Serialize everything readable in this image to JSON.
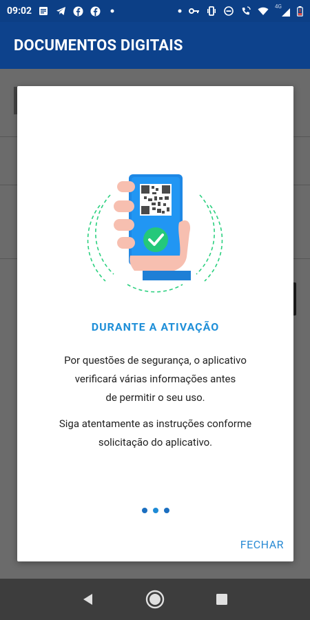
{
  "status_bar": {
    "time": "09:02",
    "network": "4G",
    "left_icons": [
      "message-icon",
      "telegram-icon",
      "facebook-icon",
      "facebook-icon",
      "dot-icon"
    ],
    "right_icons": [
      "dot-icon",
      "key-icon",
      "vibrate-icon",
      "dnd-icon",
      "wifi-call-icon",
      "wifi-icon",
      "signal-icon",
      "battery-low-icon"
    ]
  },
  "app_bar": {
    "title": "DOCUMENTOS DIGITAIS"
  },
  "dialog": {
    "illustration": "hand-holding-phone-with-qr-code-and-checkmark",
    "heading": "DURANTE A ATIVAÇÃO",
    "paragraph1_lines": [
      "Por questões de segurança, o aplicativo",
      "verificará várias informações antes",
      "de permitir o seu uso."
    ],
    "paragraph2_lines": [
      "Siga atentamente as instruções conforme",
      "solicitação do aplicativo."
    ],
    "pager": {
      "count": 3,
      "current": 1
    },
    "close_button": "FECHAR"
  },
  "nav_bar": {
    "buttons": [
      "back-icon",
      "home-icon",
      "recents-icon"
    ]
  },
  "colors": {
    "app_bar": "#0d428c",
    "status_bar": "#0c3f86",
    "heading": "#1f8fd8",
    "accent_green": "#1fc77a",
    "phone_blue": "#1e88e5"
  }
}
